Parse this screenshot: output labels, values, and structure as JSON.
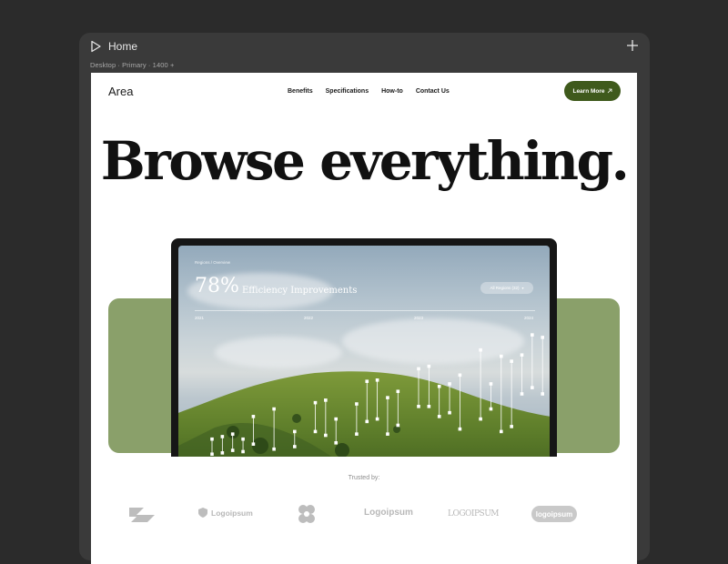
{
  "window": {
    "title": "Home",
    "frame_label": "Desktop · Primary · 1400 +"
  },
  "nav": {
    "brand": "Area",
    "links": [
      "Benefits",
      "Specifications",
      "How-to",
      "Contact Us"
    ],
    "cta_label": "Learn More",
    "cta_color": "#3f5a1c"
  },
  "hero": {
    "headline": "Browse everything."
  },
  "dashboard": {
    "breadcrumb": "Regions  /  Overview",
    "kpi_value": "78%",
    "kpi_label": "Efficiency Improvements",
    "region_select": "All Regions (32)",
    "years": [
      "2021",
      "2022",
      "2023",
      "2024"
    ],
    "band_color": "#8aa06a"
  },
  "chart_data": {
    "type": "scatter",
    "title": "",
    "xlabel": "",
    "ylabel": "",
    "categories": [
      "2021",
      "2022",
      "2023",
      "2024"
    ],
    "series": [
      {
        "values": [
          [
            0.0,
            2,
            14
          ],
          [
            0.5,
            3,
            16
          ],
          [
            1.0,
            5,
            18
          ],
          [
            1.5,
            4,
            14
          ],
          [
            2.0,
            10,
            32
          ],
          [
            3.0,
            6,
            38
          ],
          [
            4.0,
            8,
            20
          ],
          [
            5.0,
            20,
            43
          ],
          [
            5.5,
            17,
            45
          ],
          [
            6.0,
            11,
            30
          ],
          [
            7.0,
            18,
            42
          ],
          [
            7.5,
            28,
            60
          ],
          [
            8.0,
            30,
            61
          ],
          [
            8.5,
            18,
            47
          ],
          [
            9.0,
            25,
            52
          ],
          [
            10.0,
            40,
            70
          ],
          [
            10.5,
            40,
            72
          ],
          [
            11.0,
            32,
            56
          ],
          [
            11.5,
            35,
            58
          ],
          [
            12.0,
            22,
            65
          ],
          [
            13.0,
            30,
            85
          ],
          [
            13.5,
            38,
            58
          ],
          [
            14.0,
            20,
            80
          ],
          [
            14.5,
            24,
            76
          ],
          [
            15.0,
            50,
            81
          ],
          [
            15.5,
            55,
            97
          ],
          [
            16.0,
            50,
            95
          ]
        ]
      }
    ]
  },
  "trusted": {
    "label": "Trusted by:"
  },
  "logos": [
    "Logoipsum",
    "Logoipsum",
    "LOGOIPSUM",
    "logoipsum"
  ]
}
